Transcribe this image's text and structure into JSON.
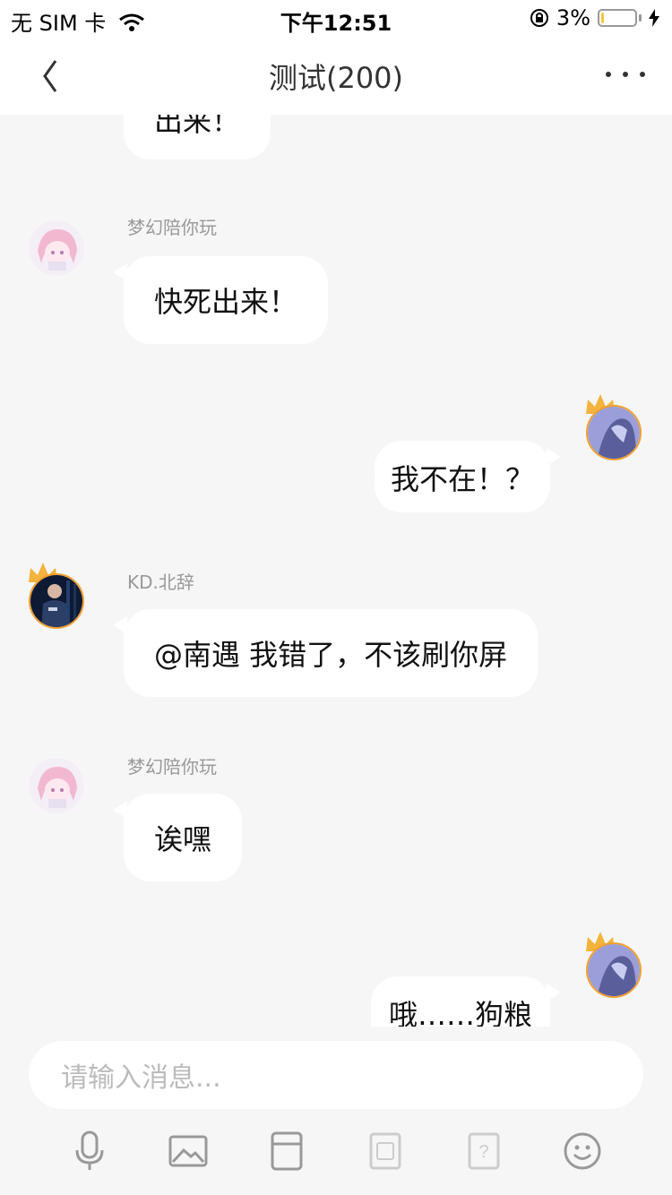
{
  "status": {
    "carrier": "无 SIM 卡",
    "time": "下午12:51",
    "battery": "3%",
    "battery_level": 0.03,
    "icons": [
      "wifi-icon",
      "rotation-lock-icon",
      "battery-icon",
      "charging-icon"
    ]
  },
  "nav": {
    "title": "测试(200)",
    "back_icon": "chevron-left-icon",
    "more_icon": "more-dots-icon"
  },
  "messages": [
    {
      "side": "left",
      "text": "出来！"
    },
    {
      "side": "left",
      "name": "梦幻陪你玩",
      "text": "快死出来！"
    },
    {
      "side": "right",
      "text": "我不在！？"
    },
    {
      "side": "left",
      "name": "KD.北辞",
      "text": "@南遇 我错了，不该刷你屏"
    },
    {
      "side": "left",
      "name": "梦幻陪你玩",
      "text": "诶嘿"
    },
    {
      "side": "right",
      "text": "哦……狗粮"
    }
  ],
  "input": {
    "placeholder": "请输入消息..."
  },
  "toolbar": {
    "icons": [
      "microphone-icon",
      "image-icon",
      "cup-icon",
      "photo-frame-icon",
      "question-icon",
      "emoji-icon"
    ]
  },
  "colors": {
    "background": "#f6f6f6",
    "bubble": "#ffffff",
    "name_text": "#999999",
    "crown": "#f3b33d",
    "accent_orange": "#f0a030"
  }
}
